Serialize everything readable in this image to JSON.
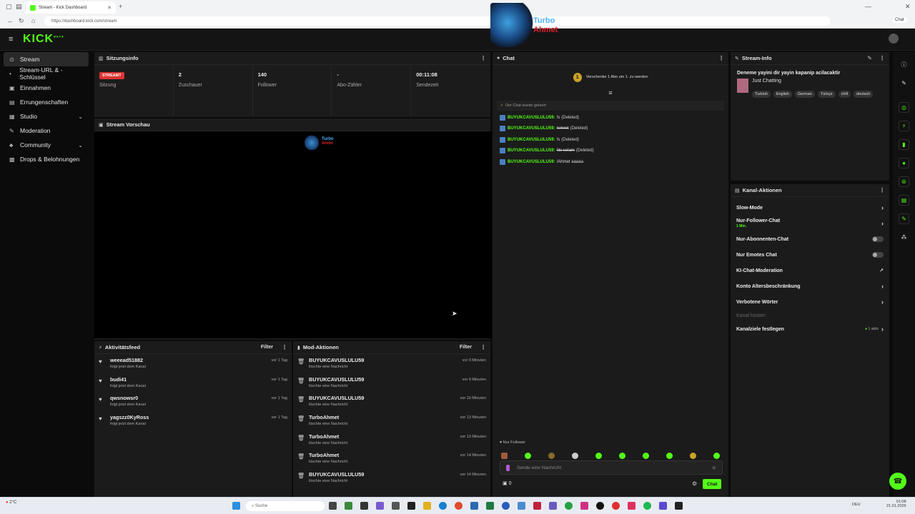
{
  "browser": {
    "tab_title": "Stream - Kick Dashboard",
    "url": "https://dashboard.kick.com/stream",
    "profile_label": "Chat"
  },
  "app": {
    "logo": "KICK",
    "logo_badge": "BETA",
    "overlay_name_1": "Turbo",
    "overlay_name_2": "Ahmet"
  },
  "sidebar": {
    "items": [
      {
        "label": "Stream",
        "icon": "stream-icon"
      },
      {
        "label": "Stream-URL & -Schlüssel",
        "icon": "key-icon"
      },
      {
        "label": "Einnahmen",
        "icon": "money-icon"
      },
      {
        "label": "Errungenschaften",
        "icon": "trophy-icon"
      },
      {
        "label": "Studio",
        "icon": "studio-icon"
      },
      {
        "label": "Moderation",
        "icon": "wrench-icon"
      },
      {
        "label": "Community",
        "icon": "community-icon"
      },
      {
        "label": "Drops & Belohnungen",
        "icon": "gift-icon"
      }
    ]
  },
  "session": {
    "title": "Sitzungsinfo",
    "stats": [
      {
        "value": "STREAMT",
        "label": "Sitzung"
      },
      {
        "value": "2",
        "label": "Zuschauer"
      },
      {
        "value": "140",
        "label": "Follower"
      },
      {
        "value": "-",
        "label": "Abo-Zähler"
      },
      {
        "value": "00:11:08",
        "label": "Sendezeit"
      }
    ]
  },
  "preview": {
    "title": "Stream Vorschau",
    "logo_1": "Turbo",
    "logo_2": "Ahmet"
  },
  "activity": {
    "title": "Aktivitätsfeed",
    "filter": "Filter",
    "items": [
      {
        "name": "weeead51882",
        "text": "folgt jetzt dem Kanal",
        "time": "vor 1 Tag"
      },
      {
        "name": "budi41",
        "text": "folgt jetzt dem Kanal",
        "time": "vor 1 Tag"
      },
      {
        "name": "qwsnowsr0",
        "text": "folgt jetzt dem Kanal",
        "time": "vor 1 Tag"
      },
      {
        "name": "yagszz0KyRoss",
        "text": "folgt jetzt dem Kanal",
        "time": "vor 1 Tag"
      }
    ]
  },
  "mod": {
    "title": "Mod-Aktionen",
    "filter": "Filter",
    "items": [
      {
        "name": "BUYUKCAVUSLULU59",
        "text": "löschte eine Nachricht",
        "time": "vor 9 Minuten"
      },
      {
        "name": "BUYUKCAVUSLULU59",
        "text": "löschte eine Nachricht",
        "time": "vor 9 Minuten"
      },
      {
        "name": "BUYUKCAVUSLULU59",
        "text": "löschte eine Nachricht",
        "time": "vor 10 Minuten"
      },
      {
        "name": "TurboAhmet",
        "text": "löschte eine Nachricht",
        "time": "vor 13 Minuten"
      },
      {
        "name": "TurboAhmet",
        "text": "löschte eine Nachricht",
        "time": "vor 13 Minuten"
      },
      {
        "name": "TurboAhmet",
        "text": "löschte eine Nachricht",
        "time": "vor 14 Minuten"
      },
      {
        "name": "BUYUKCAVUSLULU59",
        "text": "löschte eine Nachricht",
        "time": "vor 14 Minuten"
      }
    ]
  },
  "chat": {
    "title": "Chat",
    "gift_count": "1",
    "gift_text": "Verschenke 1 Abo um 1. zu werden",
    "cleared": "Der Chat wurde geleert",
    "messages": [
      {
        "user": "BUYUKCAVUSLULU59:",
        "text": "!s",
        "deleted": "(Deleted)",
        "strike": false
      },
      {
        "user": "BUYUKCAVUSLULU59:",
        "text": "!emret",
        "deleted": "(Deleted)",
        "strike": true
      },
      {
        "user": "BUYUKCAVUSLULU59:",
        "text": "!s",
        "deleted": "(Deleted)",
        "strike": false
      },
      {
        "user": "BUYUKCAVUSLULU59:",
        "text": "!its selam",
        "deleted": "(Deleted)",
        "strike": true
      },
      {
        "user": "BUYUKCAVUSLULU59:",
        "text": "!Ahmet aaaaa",
        "deleted": "",
        "strike": false
      }
    ],
    "follower_only": "Nur Follower",
    "input_placeholder": "Sende eine Nachricht",
    "counter": "0",
    "send_label": "Chat"
  },
  "stream_info": {
    "title": "Stream-Info",
    "stream_title": "Deneme yayini dir yayin kapanip acilacaktir",
    "category": "Just Chatting",
    "tags": [
      "Turkish",
      "English",
      "German",
      "Türkçe",
      "chill",
      "deutsch"
    ]
  },
  "channel_actions": {
    "title": "Kanal-Aktionen",
    "slow_mode": "Slow-Mode",
    "follower_chat": "Nur-Follower-Chat",
    "follower_chat_sub": "1 Min.",
    "sub_chat": "Nur-Abonnenten-Chat",
    "emote_chat": "Nur Emotes Chat",
    "ai_moderation": "KI-Chat-Moderation",
    "age_restriction": "Konto Altersbeschränkung",
    "banned_words": "Verbotene Wörter",
    "host": "Kanal hosten",
    "goals": "Kanalziele festlegen",
    "goals_status": "1 aktiv"
  },
  "taskbar": {
    "search": "Suche",
    "weather": "2°C",
    "lang": "DEU",
    "time": "01:08",
    "date": "21.01.2026"
  },
  "colors": {
    "accent": "#53fc18",
    "live": "#dd3333",
    "panel": "#1b1b1b",
    "background": "#0b0b0b"
  }
}
